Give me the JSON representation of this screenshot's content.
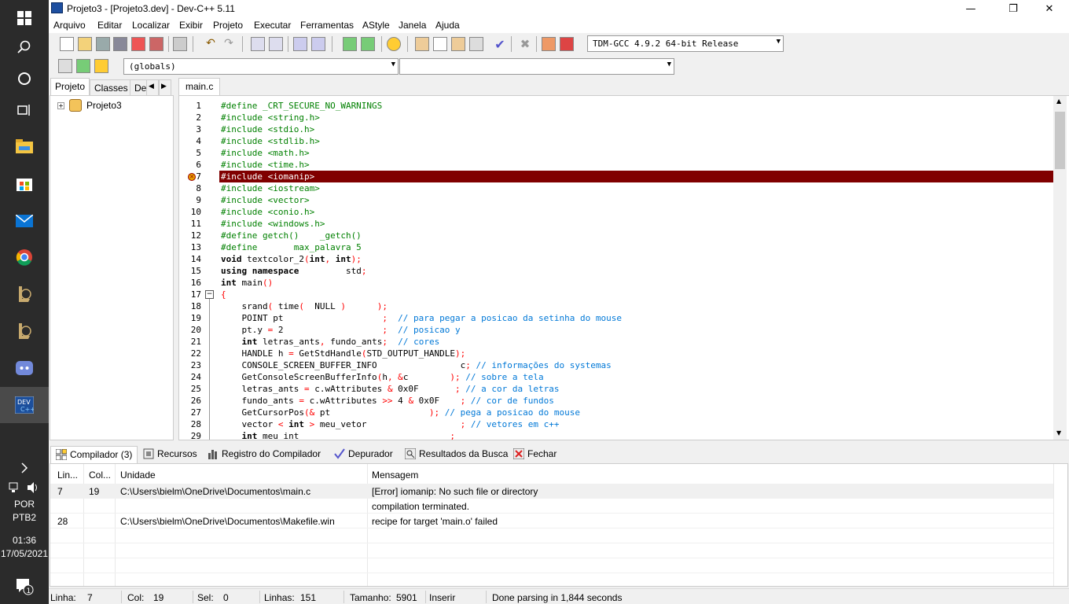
{
  "taskbar": {
    "icons": [
      "windows-start-icon",
      "search-icon",
      "cortana-icon",
      "task-view-icon",
      "file-explorer-icon",
      "store-icon",
      "mail-icon",
      "chrome-icon",
      "league-icon",
      "league-icon-2",
      "discord-icon",
      "devcpp-icon"
    ],
    "lang1": "POR",
    "lang2": "PTB2",
    "time": "01:36",
    "date": "17/05/2021",
    "notif_count": "1"
  },
  "window": {
    "title": "Projeto3 - [Projeto3.dev] - Dev-C++ 5.11",
    "minimize": "—",
    "maximize": "❐",
    "close": "✕"
  },
  "menu": [
    "Arquivo",
    "Editar",
    "Localizar",
    "Exibir",
    "Projeto",
    "Executar",
    "Ferramentas",
    "AStyle",
    "Janela",
    "Ajuda"
  ],
  "toolbar": {
    "compiler_select": "TDM-GCC 4.9.2 64-bit Release",
    "scope_select": "(globals)",
    "member_select": ""
  },
  "left_tabs": [
    "Projeto",
    "Classes",
    "De"
  ],
  "tree": {
    "project": "Projeto3"
  },
  "editor_tab": "main.c",
  "code_lines": [
    {
      "n": "1",
      "segs": [
        [
          "#define _CRT_SECURE_NO_WARNINGS",
          "pp"
        ]
      ]
    },
    {
      "n": "2",
      "segs": [
        [
          "#include <string.h>",
          "pp"
        ]
      ]
    },
    {
      "n": "3",
      "segs": [
        [
          "#include <stdio.h>",
          "pp"
        ]
      ]
    },
    {
      "n": "4",
      "segs": [
        [
          "#include <stdlib.h>",
          "pp"
        ]
      ]
    },
    {
      "n": "5",
      "segs": [
        [
          "#include <math.h>",
          "pp"
        ]
      ]
    },
    {
      "n": "6",
      "segs": [
        [
          "#include <time.h>",
          "pp"
        ]
      ]
    },
    {
      "n": "7",
      "segs": [
        [
          "#include <iomanip>",
          "err"
        ]
      ]
    },
    {
      "n": "8",
      "segs": [
        [
          "#include <iostream>",
          "pp"
        ]
      ]
    },
    {
      "n": "9",
      "segs": [
        [
          "#include <vector>",
          "pp"
        ]
      ]
    },
    {
      "n": "10",
      "segs": [
        [
          "#include <conio.h>",
          "pp"
        ]
      ]
    },
    {
      "n": "11",
      "segs": [
        [
          "#include <windows.h>",
          "pp"
        ]
      ]
    },
    {
      "n": "12",
      "segs": [
        [
          "#define getch()    _getch()",
          "pp"
        ]
      ]
    },
    {
      "n": "13",
      "segs": [
        [
          "#define       max_palavra 5",
          "pp"
        ]
      ]
    },
    {
      "n": "14",
      "segs": [
        [
          "void",
          "kw"
        ],
        [
          " textcolor_2",
          ""
        ],
        [
          "(",
          "sym"
        ],
        [
          "int",
          "kw"
        ],
        [
          ", ",
          "sym"
        ],
        [
          "int",
          "kw"
        ],
        [
          ");",
          "sym"
        ]
      ]
    },
    {
      "n": "15",
      "segs": [
        [
          "using namespace",
          "kw"
        ],
        [
          "         std",
          ""
        ],
        [
          ";",
          "sym"
        ]
      ]
    },
    {
      "n": "16",
      "segs": [
        [
          "int",
          "kw"
        ],
        [
          " main",
          ""
        ],
        [
          "()",
          "sym"
        ]
      ]
    },
    {
      "n": "17",
      "segs": [
        [
          "{",
          "sym"
        ]
      ]
    },
    {
      "n": "18",
      "segs": [
        [
          "    srand",
          ""
        ],
        [
          "(",
          "sym"
        ],
        [
          " time",
          ""
        ],
        [
          "(",
          "sym"
        ],
        [
          "  NULL ",
          ""
        ],
        [
          ")",
          "sym"
        ],
        [
          "      ",
          ""
        ],
        [
          ");",
          "sym"
        ]
      ]
    },
    {
      "n": "19",
      "segs": [
        [
          "    POINT pt                   ",
          ""
        ],
        [
          ";",
          "sym"
        ],
        [
          "  // para pegar a posicao da setinha do mouse",
          "cm"
        ]
      ]
    },
    {
      "n": "20",
      "segs": [
        [
          "    pt.y ",
          ""
        ],
        [
          "=",
          "sym"
        ],
        [
          " 2                   ",
          ""
        ],
        [
          ";",
          "sym"
        ],
        [
          "  // posicao y",
          "cm"
        ]
      ]
    },
    {
      "n": "21",
      "segs": [
        [
          "    ",
          ""
        ],
        [
          "int",
          "kw"
        ],
        [
          " letras_ants",
          ""
        ],
        [
          ",",
          "sym"
        ],
        [
          " fundo_ants",
          ""
        ],
        [
          ";",
          "sym"
        ],
        [
          "  // cores",
          "cm"
        ]
      ]
    },
    {
      "n": "22",
      "segs": [
        [
          "    HANDLE h ",
          ""
        ],
        [
          "=",
          "sym"
        ],
        [
          " GetStdHandle",
          ""
        ],
        [
          "(",
          "sym"
        ],
        [
          "STD_OUTPUT_HANDLE",
          ""
        ],
        [
          ");",
          "sym"
        ]
      ]
    },
    {
      "n": "23",
      "segs": [
        [
          "    CONSOLE_SCREEN_BUFFER_INFO                c",
          ""
        ],
        [
          ";",
          "sym"
        ],
        [
          " // informações do systemas",
          "cm"
        ]
      ]
    },
    {
      "n": "24",
      "segs": [
        [
          "    GetConsoleScreenBufferInfo",
          ""
        ],
        [
          "(",
          "sym"
        ],
        [
          "h",
          ""
        ],
        [
          ", &",
          "sym"
        ],
        [
          "c        ",
          ""
        ],
        [
          ");",
          "sym"
        ],
        [
          " // sobre a tela",
          "cm"
        ]
      ]
    },
    {
      "n": "25",
      "segs": [
        [
          "    letras_ants ",
          ""
        ],
        [
          "=",
          "sym"
        ],
        [
          " c.wAttributes ",
          ""
        ],
        [
          "&",
          "sym"
        ],
        [
          " 0x0F",
          ""
        ],
        [
          "       ;",
          "sym"
        ],
        [
          " // a cor da letras",
          "cm"
        ]
      ]
    },
    {
      "n": "26",
      "segs": [
        [
          "    fundo_ants ",
          ""
        ],
        [
          "=",
          "sym"
        ],
        [
          " c.wAttributes ",
          ""
        ],
        [
          ">>",
          "sym"
        ],
        [
          " 4 ",
          ""
        ],
        [
          "&",
          "sym"
        ],
        [
          " 0x0F",
          ""
        ],
        [
          "    ;",
          "sym"
        ],
        [
          " // cor de fundos",
          "cm"
        ]
      ]
    },
    {
      "n": "27",
      "segs": [
        [
          "    GetCursorPos",
          ""
        ],
        [
          "(&",
          "sym"
        ],
        [
          " pt                   ",
          ""
        ],
        [
          ");",
          "sym"
        ],
        [
          " // pega a posicao do mouse",
          "cm"
        ]
      ]
    },
    {
      "n": "28",
      "segs": [
        [
          "    vector ",
          ""
        ],
        [
          "<",
          "sym"
        ],
        [
          " ",
          ""
        ],
        [
          "int",
          "kw"
        ],
        [
          " ",
          ""
        ],
        [
          ">",
          "sym"
        ],
        [
          " meu_vetor                  ",
          ""
        ],
        [
          ";",
          "sym"
        ],
        [
          " // vetores em c++",
          "cm"
        ]
      ]
    },
    {
      "n": "29",
      "segs": [
        [
          "    ",
          ""
        ],
        [
          "int",
          "kw"
        ],
        [
          " meu_int                             ",
          ""
        ],
        [
          ";",
          "sym"
        ]
      ]
    }
  ],
  "bottom_tabs": [
    "Compilador (3)",
    "Recursos",
    "Registro do Compilador",
    "Depurador",
    "Resultados da Busca",
    "Fechar"
  ],
  "messages": {
    "headers": [
      "Lin...",
      "Col...",
      "Unidade",
      "Mensagem"
    ],
    "rows": [
      [
        "7",
        "19",
        "C:\\Users\\bielm\\OneDrive\\Documentos\\main.c",
        "[Error] iomanip: No such file or directory"
      ],
      [
        "",
        "",
        "",
        "compilation terminated."
      ],
      [
        "28",
        "",
        "C:\\Users\\bielm\\OneDrive\\Documentos\\Makefile.win",
        "recipe for target 'main.o' failed"
      ]
    ]
  },
  "status": {
    "linha_label": "Linha:",
    "linha": "7",
    "col_label": "Col:",
    "col": "19",
    "sel_label": "Sel:",
    "sel": "0",
    "linhas_label": "Linhas:",
    "linhas": "151",
    "tamanho_label": "Tamanho:",
    "tamanho": "5901",
    "mode": "Inserir",
    "msg": "Done parsing in 1,844 seconds"
  },
  "colors": {
    "preprocessor": "#008000",
    "keyword": "#000000",
    "symbol": "#ff0000",
    "comment": "#0078d7",
    "error_line_bg": "#800000"
  }
}
